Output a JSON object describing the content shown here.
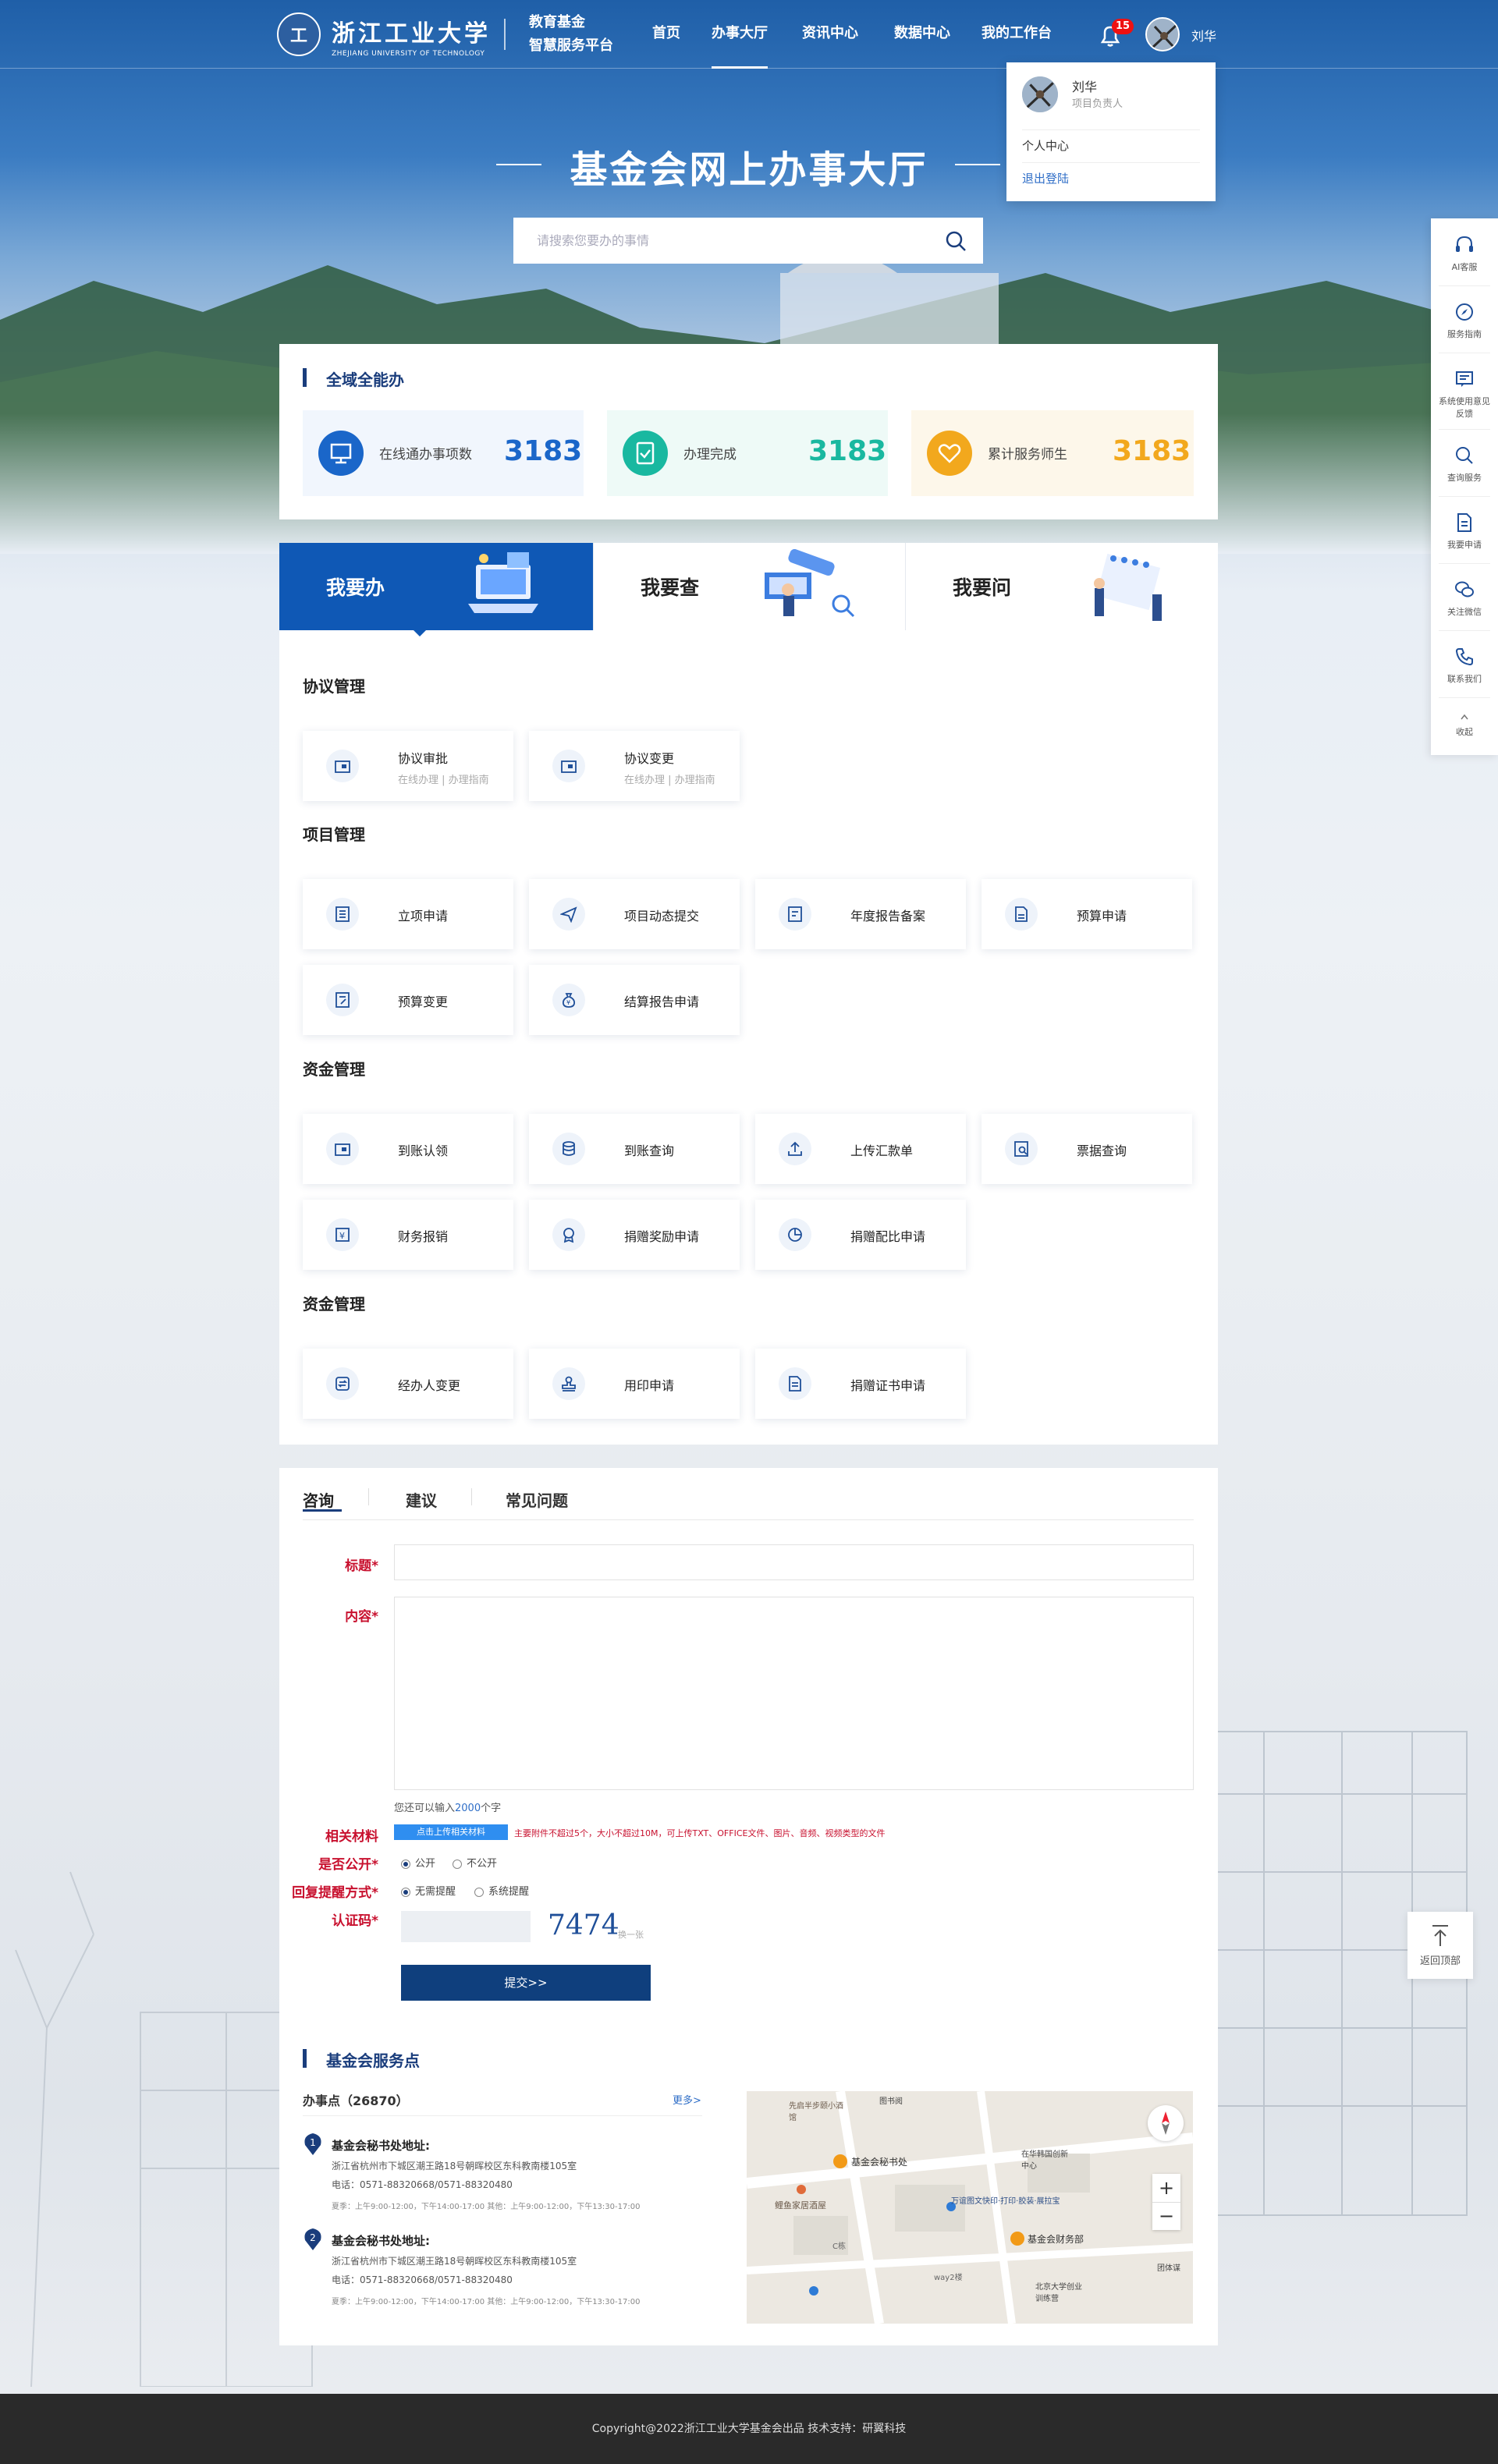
{
  "header": {
    "school_name_cn": "浙江工业大学",
    "school_name_en": "ZHEJIANG UNIVERSITY OF TECHNOLOGY",
    "platform_line1": "教育基金",
    "platform_line2": "智慧服务平台",
    "nav": [
      "首页",
      "办事大厅",
      "资讯中心",
      "数据中心",
      "我的工作台"
    ],
    "active_nav": "办事大厅",
    "notification_count": "15",
    "user_name": "刘华"
  },
  "user_menu": {
    "name": "刘华",
    "role": "项目负责人",
    "items": [
      "个人中心",
      "退出登陆"
    ]
  },
  "hero": {
    "title": "基金会网上办事大厅",
    "search_placeholder": "请搜索您要办的事情"
  },
  "overview": {
    "title": "全域全能办",
    "stats": [
      {
        "label": "在线通办事项数",
        "value": "3183",
        "color": "#1a66c9",
        "icon": "monitor-icon"
      },
      {
        "label": "办理完成",
        "value": "3183",
        "color": "#19b8a0",
        "icon": "clipboard-check-icon"
      },
      {
        "label": "累计服务师生",
        "value": "3183",
        "color": "#f2a81d",
        "icon": "heart-icon"
      }
    ]
  },
  "tabs": [
    "我要办",
    "我要查",
    "我要问"
  ],
  "active_tab": "我要办",
  "services": {
    "cat1": {
      "title": "协议管理",
      "items": [
        {
          "label": "协议审批",
          "sub": "在线办理 | 办理指南"
        },
        {
          "label": "协议变更",
          "sub": "在线办理 | 办理指南"
        }
      ]
    },
    "cat2": {
      "title": "项目管理",
      "items": [
        {
          "label": "立项申请"
        },
        {
          "label": "项目动态提交"
        },
        {
          "label": "年度报告备案"
        },
        {
          "label": "预算申请"
        },
        {
          "label": "预算变更"
        },
        {
          "label": "结算报告申请"
        }
      ]
    },
    "cat3": {
      "title": "资金管理",
      "items": [
        {
          "label": "到账认领"
        },
        {
          "label": "到账查询"
        },
        {
          "label": "上传汇款单"
        },
        {
          "label": "票据查询"
        },
        {
          "label": "财务报销"
        },
        {
          "label": "捐赠奖励申请"
        },
        {
          "label": "捐赠配比申请"
        }
      ]
    },
    "cat4": {
      "title": "资金管理",
      "items": [
        {
          "label": "经办人变更"
        },
        {
          "label": "用印申请"
        },
        {
          "label": "捐赠证书申请"
        }
      ]
    }
  },
  "feedback": {
    "tabs": [
      "咨询",
      "建议",
      "常见问题"
    ],
    "title_label": "标题",
    "content_label": "内容",
    "remaining_prefix": "您还可以输入",
    "remaining_count": "2000",
    "remaining_suffix": "个字",
    "attach_label": "相关材料",
    "attach_button": "点击上传相关材料",
    "attach_note": "主要附件不超过5个，大小不超过10M，可上传TXT、OFFICE文件、图片、音频、视频类型的文件",
    "public_label": "是否公开",
    "public_options": [
      "公开",
      "不公开"
    ],
    "remind_label": "回复提醒方式",
    "remind_options": [
      "无需提醒",
      "系统提醒"
    ],
    "captcha_label": "认证码",
    "captcha_code": "7474",
    "captcha_refresh": "换一张",
    "submit": "提交>>"
  },
  "service_points": {
    "title": "基金会服务点",
    "count_label": "办事点（26870）",
    "more": "更多>",
    "points": [
      {
        "num": "1",
        "name": "基金会秘书处地址:",
        "addr": "浙江省杭州市下城区潮王路18号朝晖校区东科教南楼105室",
        "tel": "电话：0571-88320668/0571-88320480",
        "hours": "夏季：上午9:00-12:00，下午14:00-17:00    其他：上午9:00-12:00，下午13:30-17:00"
      },
      {
        "num": "2",
        "name": "基金会秘书处地址:",
        "addr": "浙江省杭州市下城区潮王路18号朝晖校区东科教南楼105室",
        "tel": "电话：0571-88320668/0571-88320480",
        "hours": "夏季：上午9:00-12:00，下午14:00-17:00    其他：上午9:00-12:00，下午13:30-17:00"
      }
    ],
    "map_labels": [
      "基金会秘书处",
      "基金会财务部",
      "鲤鱼家居酒屋",
      "万谊图文快印·打印·胶装·展拉宝",
      "在华韩国创新中心",
      "北京大学创业训练营",
      "C栋",
      "way2楼",
      "图书阅",
      "先启半步颐小酒馆",
      "团体谋"
    ]
  },
  "sidebar": [
    "AI客服",
    "服务指南",
    "系统使用意见反馈",
    "查询服务",
    "我要申请",
    "关注微信",
    "联系我们",
    "收起"
  ],
  "back_to_top": "返回顶部",
  "footer": "Copyright@2022浙江工业大学基金会出品    技术支持：研翼科技"
}
